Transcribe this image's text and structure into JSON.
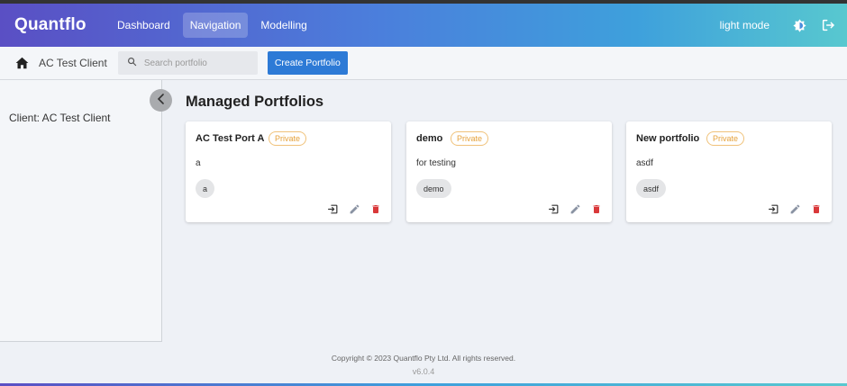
{
  "app": {
    "brand": "Quantflo"
  },
  "nav": {
    "items": [
      {
        "label": "Dashboard",
        "active": false
      },
      {
        "label": "Navigation",
        "active": true
      },
      {
        "label": "Modelling",
        "active": false
      }
    ]
  },
  "header": {
    "mode_label": "light mode",
    "icons": [
      "brightness-icon",
      "logout-icon"
    ]
  },
  "subbar": {
    "client_name": "AC Test Client",
    "search_placeholder": "Search portfolio",
    "create_label": "Create Portfolio"
  },
  "sidebar": {
    "client_label": "Client: AC Test Client"
  },
  "main": {
    "title": "Managed Portfolios",
    "cards": [
      {
        "title": "AC Test Port A",
        "badge": "Private",
        "description": "a",
        "tag": "a"
      },
      {
        "title": "demo",
        "badge": "Private",
        "description": "for testing",
        "tag": "demo"
      },
      {
        "title": "New portfolio",
        "badge": "Private",
        "description": "asdf",
        "tag": "asdf"
      }
    ]
  },
  "footer": {
    "copyright": "Copyright © 2023 Quantflo Pty Ltd. All rights reserved.",
    "version": "v6.0.4"
  },
  "colors": {
    "primary": "#2d7ad6",
    "badge": "#e6a23c",
    "delete": "#d9383a",
    "edit": "#8a93a3"
  }
}
